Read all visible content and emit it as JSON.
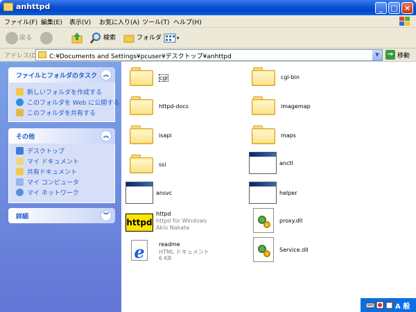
{
  "window": {
    "title": "anhttpd"
  },
  "menu": [
    "ファイル(F)",
    "編集(E)",
    "表示(V)",
    "お気に入り(A)",
    "ツール(T)",
    "ヘルプ(H)"
  ],
  "toolbar": {
    "back": "戻る",
    "search": "検索",
    "folders": "フォルダ"
  },
  "address": {
    "label": "アドレス(D)",
    "path": "C:¥Documents and Settings¥pcuser¥デスクトップ¥anhttpd",
    "go_label": "移動"
  },
  "sidebar": {
    "tasks": {
      "title": "ファイルとフォルダのタスク",
      "items": [
        "新しいフォルダを作成する",
        "このフォルダを Web に公開する",
        "このフォルダを共有する"
      ]
    },
    "other": {
      "title": "その他",
      "items": [
        "デスクトップ",
        "マイ ドキュメント",
        "共有ドキュメント",
        "マイ コンピュータ",
        "マイ ネットワーク"
      ]
    },
    "details": {
      "title": "詳細"
    }
  },
  "files": {
    "cgi": {
      "name": "cgi"
    },
    "cgi_bin": {
      "name": "cgi-bin"
    },
    "httpd_docs": {
      "name": "httpd-docs"
    },
    "imagemap": {
      "name": "imagemap"
    },
    "isapi": {
      "name": "isapi"
    },
    "maps": {
      "name": "maps"
    },
    "ssi": {
      "name": "ssi"
    },
    "anctl": {
      "name": "anctl"
    },
    "ansvc": {
      "name": "ansvc"
    },
    "helper": {
      "name": "helper"
    },
    "httpd": {
      "name": "httpd",
      "line2": "httpd for Windows",
      "line3": "Akio Nakata",
      "icon_text": "httpd"
    },
    "proxy": {
      "name": "proxy.dll"
    },
    "readme": {
      "name": "readme",
      "line2": "HTML ドキュメント",
      "line3": "6 KB"
    },
    "service": {
      "name": "Service.dll"
    }
  },
  "taskbar": {
    "ime": "A 般"
  },
  "colors": {
    "title_blue": "#0a53d6",
    "sidebar_blue": "#7ba2e7",
    "link_blue": "#215dc6",
    "panel_bg": "#d6dff7",
    "menu_bg": "#ece9d8"
  }
}
